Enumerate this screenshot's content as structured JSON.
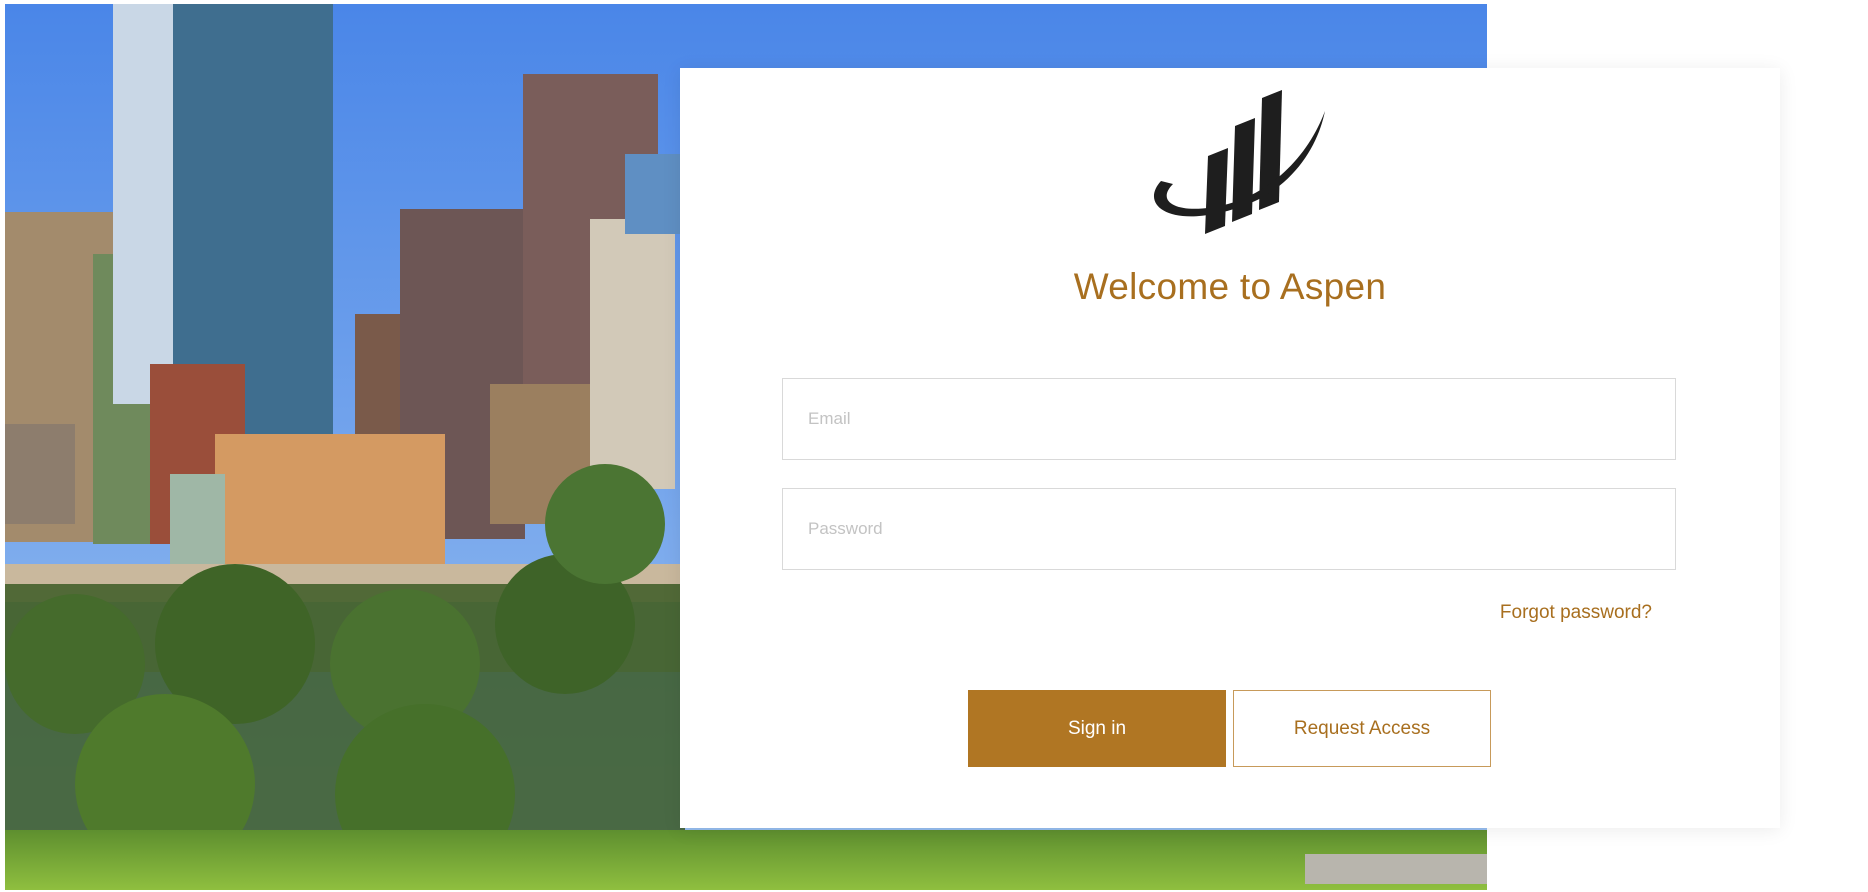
{
  "login": {
    "title": "Welcome to Aspen",
    "email_placeholder": "Email",
    "password_placeholder": "Password",
    "forgot_password": "Forgot password?",
    "signin_label": "Sign in",
    "request_access_label": "Request Access"
  },
  "icons": {
    "logo": "aspen-logo-icon"
  },
  "colors": {
    "accent": "#b07623",
    "title_text": "#a86f1f",
    "input_border": "#d9d9d9",
    "card_background": "#ffffff"
  }
}
